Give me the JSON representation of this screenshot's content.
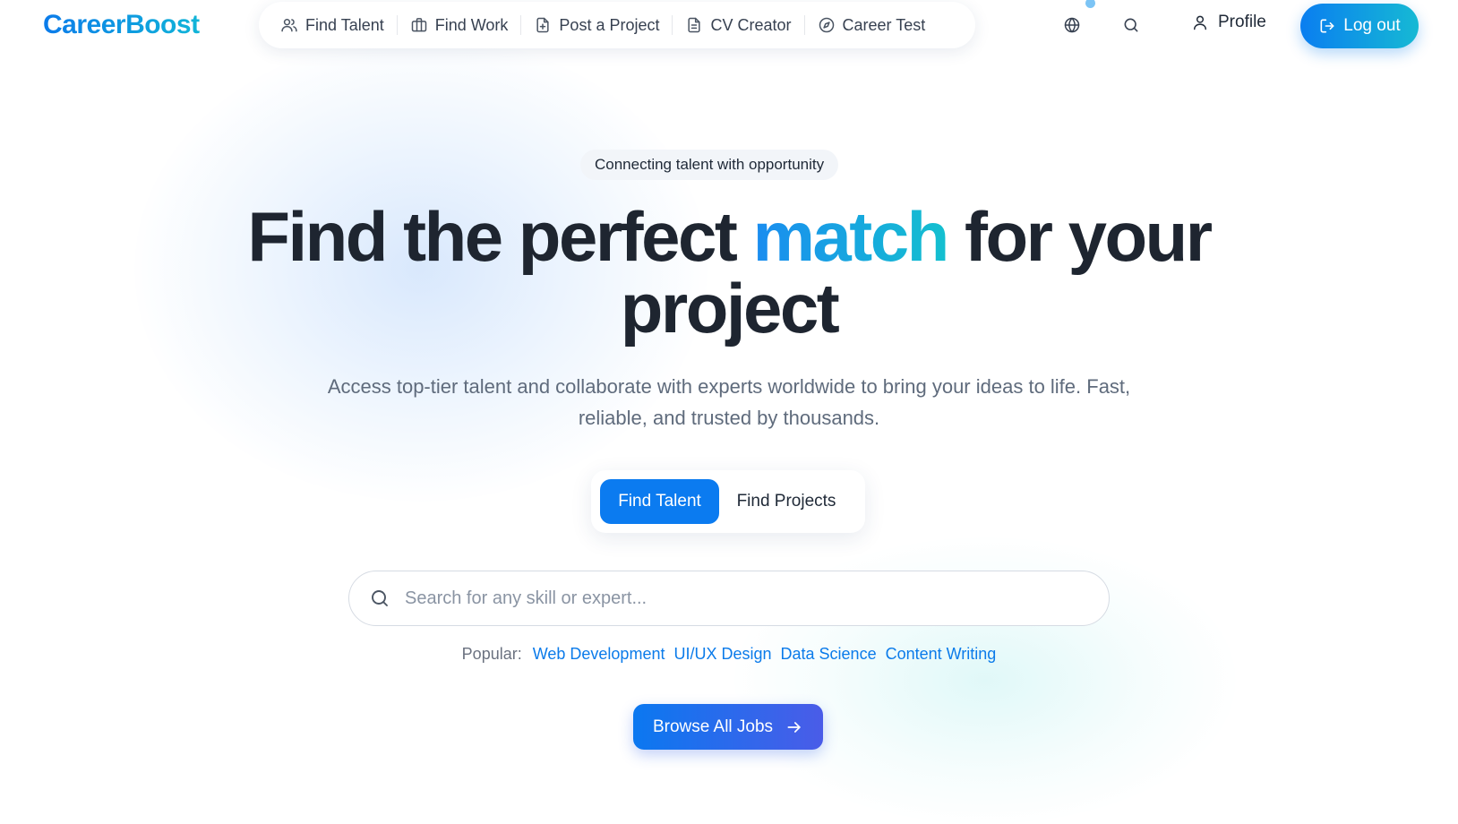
{
  "brand": {
    "logo_text": "CareerBoost",
    "primary_color": "#0b7bf0",
    "accent_gradient": [
      "#1a8cf0",
      "#14c0cf"
    ]
  },
  "nav": {
    "items": [
      {
        "label": "Find Talent",
        "icon": "users-icon"
      },
      {
        "label": "Find Work",
        "icon": "briefcase-icon"
      },
      {
        "label": "Post a Project",
        "icon": "file-plus-icon"
      },
      {
        "label": "CV Creator",
        "icon": "document-icon"
      },
      {
        "label": "Career Test",
        "icon": "compass-icon"
      }
    ]
  },
  "header": {
    "language_icon": "globe-icon",
    "search_icon": "search-icon",
    "profile_label": "Profile",
    "logout_label": "Log out"
  },
  "hero": {
    "tagline": "Connecting talent with opportunity",
    "headline_part1": "Find the perfect ",
    "headline_accent": "match",
    "headline_part2": " for your project",
    "subtext": "Access top-tier talent and collaborate with experts worldwide to bring your ideas to life. Fast, reliable, and trusted by thousands."
  },
  "toggle": {
    "active_label": "Find Talent",
    "inactive_label": "Find Projects"
  },
  "search": {
    "placeholder": "Search for any skill or expert...",
    "value": ""
  },
  "popular": {
    "label": "Popular:",
    "tags": [
      "Web Development",
      "UI/UX Design",
      "Data Science",
      "Content Writing"
    ]
  },
  "cta": {
    "browse_label": "Browse All Jobs"
  }
}
